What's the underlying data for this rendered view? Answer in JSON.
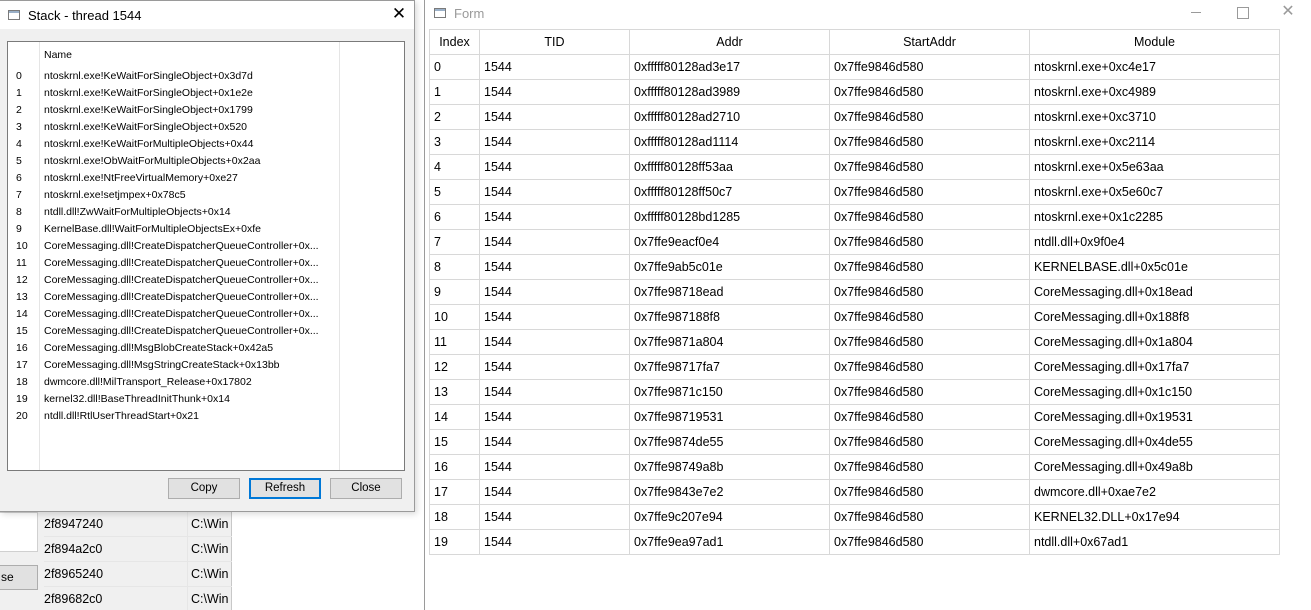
{
  "stack_window": {
    "title": "Stack - thread 1544",
    "close_glyph": "✕",
    "column_header": "Name",
    "frames": [
      {
        "index": "0",
        "name": "ntoskrnl.exe!KeWaitForSingleObject+0x3d7d"
      },
      {
        "index": "1",
        "name": "ntoskrnl.exe!KeWaitForSingleObject+0x1e2e"
      },
      {
        "index": "2",
        "name": "ntoskrnl.exe!KeWaitForSingleObject+0x1799"
      },
      {
        "index": "3",
        "name": "ntoskrnl.exe!KeWaitForSingleObject+0x520"
      },
      {
        "index": "4",
        "name": "ntoskrnl.exe!KeWaitForMultipleObjects+0x44"
      },
      {
        "index": "5",
        "name": "ntoskrnl.exe!ObWaitForMultipleObjects+0x2aa"
      },
      {
        "index": "6",
        "name": "ntoskrnl.exe!NtFreeVirtualMemory+0xe27"
      },
      {
        "index": "7",
        "name": "ntoskrnl.exe!setjmpex+0x78c5"
      },
      {
        "index": "8",
        "name": "ntdll.dll!ZwWaitForMultipleObjects+0x14"
      },
      {
        "index": "9",
        "name": "KernelBase.dll!WaitForMultipleObjectsEx+0xfe"
      },
      {
        "index": "10",
        "name": "CoreMessaging.dll!CreateDispatcherQueueController+0x..."
      },
      {
        "index": "11",
        "name": "CoreMessaging.dll!CreateDispatcherQueueController+0x..."
      },
      {
        "index": "12",
        "name": "CoreMessaging.dll!CreateDispatcherQueueController+0x..."
      },
      {
        "index": "13",
        "name": "CoreMessaging.dll!CreateDispatcherQueueController+0x..."
      },
      {
        "index": "14",
        "name": "CoreMessaging.dll!CreateDispatcherQueueController+0x..."
      },
      {
        "index": "15",
        "name": "CoreMessaging.dll!CreateDispatcherQueueController+0x..."
      },
      {
        "index": "16",
        "name": "CoreMessaging.dll!MsgBlobCreateStack+0x42a5"
      },
      {
        "index": "17",
        "name": "CoreMessaging.dll!MsgStringCreateStack+0x13bb"
      },
      {
        "index": "18",
        "name": "dwmcore.dll!MilTransport_Release+0x17802"
      },
      {
        "index": "19",
        "name": "kernel32.dll!BaseThreadInitThunk+0x14"
      },
      {
        "index": "20",
        "name": "ntdll.dll!RtlUserThreadStart+0x21"
      }
    ],
    "buttons": {
      "copy": "Copy",
      "refresh": "Refresh",
      "close": "Close"
    }
  },
  "form_window": {
    "title": "Form",
    "controls": {
      "minimize": "",
      "maximize": "",
      "close": "✕"
    },
    "columns": [
      "Index",
      "TID",
      "Addr",
      "StartAddr",
      "Module"
    ],
    "rows": [
      [
        "0",
        "1544",
        "0xfffff80128ad3e17",
        "0x7ffe9846d580",
        "ntoskrnl.exe+0xc4e17"
      ],
      [
        "1",
        "1544",
        "0xfffff80128ad3989",
        "0x7ffe9846d580",
        "ntoskrnl.exe+0xc4989"
      ],
      [
        "2",
        "1544",
        "0xfffff80128ad2710",
        "0x7ffe9846d580",
        "ntoskrnl.exe+0xc3710"
      ],
      [
        "3",
        "1544",
        "0xfffff80128ad1114",
        "0x7ffe9846d580",
        "ntoskrnl.exe+0xc2114"
      ],
      [
        "4",
        "1544",
        "0xfffff80128ff53aa",
        "0x7ffe9846d580",
        "ntoskrnl.exe+0x5e63aa"
      ],
      [
        "5",
        "1544",
        "0xfffff80128ff50c7",
        "0x7ffe9846d580",
        "ntoskrnl.exe+0x5e60c7"
      ],
      [
        "6",
        "1544",
        "0xfffff80128bd1285",
        "0x7ffe9846d580",
        "ntoskrnl.exe+0x1c2285"
      ],
      [
        "7",
        "1544",
        "0x7ffe9eacf0e4",
        "0x7ffe9846d580",
        "ntdll.dll+0x9f0e4"
      ],
      [
        "8",
        "1544",
        "0x7ffe9ab5c01e",
        "0x7ffe9846d580",
        "KERNELBASE.dll+0x5c01e"
      ],
      [
        "9",
        "1544",
        "0x7ffe98718ead",
        "0x7ffe9846d580",
        "CoreMessaging.dll+0x18ead"
      ],
      [
        "10",
        "1544",
        "0x7ffe987188f8",
        "0x7ffe9846d580",
        "CoreMessaging.dll+0x188f8"
      ],
      [
        "11",
        "1544",
        "0x7ffe9871a804",
        "0x7ffe9846d580",
        "CoreMessaging.dll+0x1a804"
      ],
      [
        "12",
        "1544",
        "0x7ffe98717fa7",
        "0x7ffe9846d580",
        "CoreMessaging.dll+0x17fa7"
      ],
      [
        "13",
        "1544",
        "0x7ffe9871c150",
        "0x7ffe9846d580",
        "CoreMessaging.dll+0x1c150"
      ],
      [
        "14",
        "1544",
        "0x7ffe98719531",
        "0x7ffe9846d580",
        "CoreMessaging.dll+0x19531"
      ],
      [
        "15",
        "1544",
        "0x7ffe9874de55",
        "0x7ffe9846d580",
        "CoreMessaging.dll+0x4de55"
      ],
      [
        "16",
        "1544",
        "0x7ffe98749a8b",
        "0x7ffe9846d580",
        "CoreMessaging.dll+0x49a8b"
      ],
      [
        "17",
        "1544",
        "0x7ffe9843e7e2",
        "0x7ffe9846d580",
        "dwmcore.dll+0xae7e2"
      ],
      [
        "18",
        "1544",
        "0x7ffe9c207e94",
        "0x7ffe9846d580",
        "KERNEL32.DLL+0x17e94"
      ],
      [
        "19",
        "1544",
        "0x7ffe9ea97ad1",
        "0x7ffe9846d580",
        "ntdll.dll+0x67ad1"
      ]
    ]
  },
  "background_window": {
    "button_label": "se",
    "rows": [
      {
        "addr": "2f8947240",
        "path": "C:\\Win"
      },
      {
        "addr": "2f894a2c0",
        "path": "C:\\Win"
      },
      {
        "addr": "2f8965240",
        "path": "C:\\Win"
      },
      {
        "addr": "2f89682c0",
        "path": "C:\\Win"
      }
    ]
  },
  "colors": {
    "accent": "#0078d7",
    "dialog_bg": "#f0f0f0",
    "grid_line": "#d8d8d8"
  }
}
